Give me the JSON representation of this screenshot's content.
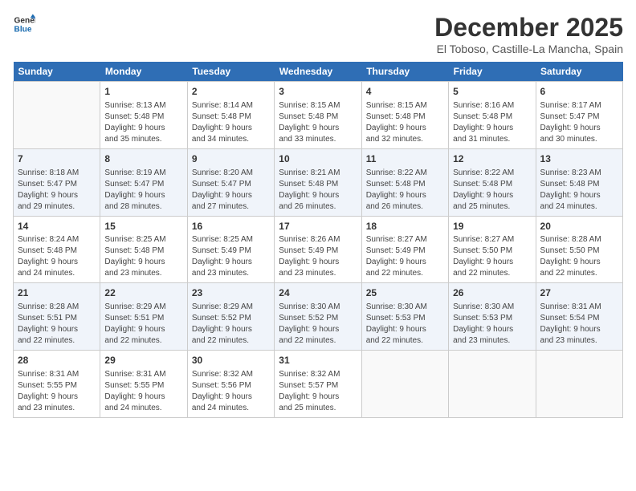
{
  "logo": {
    "line1": "General",
    "line2": "Blue"
  },
  "title": "December 2025",
  "subtitle": "El Toboso, Castille-La Mancha, Spain",
  "days_of_week": [
    "Sunday",
    "Monday",
    "Tuesday",
    "Wednesday",
    "Thursday",
    "Friday",
    "Saturday"
  ],
  "weeks": [
    [
      {
        "day": "",
        "info": ""
      },
      {
        "day": "1",
        "info": "Sunrise: 8:13 AM\nSunset: 5:48 PM\nDaylight: 9 hours\nand 35 minutes."
      },
      {
        "day": "2",
        "info": "Sunrise: 8:14 AM\nSunset: 5:48 PM\nDaylight: 9 hours\nand 34 minutes."
      },
      {
        "day": "3",
        "info": "Sunrise: 8:15 AM\nSunset: 5:48 PM\nDaylight: 9 hours\nand 33 minutes."
      },
      {
        "day": "4",
        "info": "Sunrise: 8:15 AM\nSunset: 5:48 PM\nDaylight: 9 hours\nand 32 minutes."
      },
      {
        "day": "5",
        "info": "Sunrise: 8:16 AM\nSunset: 5:48 PM\nDaylight: 9 hours\nand 31 minutes."
      },
      {
        "day": "6",
        "info": "Sunrise: 8:17 AM\nSunset: 5:47 PM\nDaylight: 9 hours\nand 30 minutes."
      }
    ],
    [
      {
        "day": "7",
        "info": "Sunrise: 8:18 AM\nSunset: 5:47 PM\nDaylight: 9 hours\nand 29 minutes."
      },
      {
        "day": "8",
        "info": "Sunrise: 8:19 AM\nSunset: 5:47 PM\nDaylight: 9 hours\nand 28 minutes."
      },
      {
        "day": "9",
        "info": "Sunrise: 8:20 AM\nSunset: 5:47 PM\nDaylight: 9 hours\nand 27 minutes."
      },
      {
        "day": "10",
        "info": "Sunrise: 8:21 AM\nSunset: 5:48 PM\nDaylight: 9 hours\nand 26 minutes."
      },
      {
        "day": "11",
        "info": "Sunrise: 8:22 AM\nSunset: 5:48 PM\nDaylight: 9 hours\nand 26 minutes."
      },
      {
        "day": "12",
        "info": "Sunrise: 8:22 AM\nSunset: 5:48 PM\nDaylight: 9 hours\nand 25 minutes."
      },
      {
        "day": "13",
        "info": "Sunrise: 8:23 AM\nSunset: 5:48 PM\nDaylight: 9 hours\nand 24 minutes."
      }
    ],
    [
      {
        "day": "14",
        "info": "Sunrise: 8:24 AM\nSunset: 5:48 PM\nDaylight: 9 hours\nand 24 minutes."
      },
      {
        "day": "15",
        "info": "Sunrise: 8:25 AM\nSunset: 5:48 PM\nDaylight: 9 hours\nand 23 minutes."
      },
      {
        "day": "16",
        "info": "Sunrise: 8:25 AM\nSunset: 5:49 PM\nDaylight: 9 hours\nand 23 minutes."
      },
      {
        "day": "17",
        "info": "Sunrise: 8:26 AM\nSunset: 5:49 PM\nDaylight: 9 hours\nand 23 minutes."
      },
      {
        "day": "18",
        "info": "Sunrise: 8:27 AM\nSunset: 5:49 PM\nDaylight: 9 hours\nand 22 minutes."
      },
      {
        "day": "19",
        "info": "Sunrise: 8:27 AM\nSunset: 5:50 PM\nDaylight: 9 hours\nand 22 minutes."
      },
      {
        "day": "20",
        "info": "Sunrise: 8:28 AM\nSunset: 5:50 PM\nDaylight: 9 hours\nand 22 minutes."
      }
    ],
    [
      {
        "day": "21",
        "info": "Sunrise: 8:28 AM\nSunset: 5:51 PM\nDaylight: 9 hours\nand 22 minutes."
      },
      {
        "day": "22",
        "info": "Sunrise: 8:29 AM\nSunset: 5:51 PM\nDaylight: 9 hours\nand 22 minutes."
      },
      {
        "day": "23",
        "info": "Sunrise: 8:29 AM\nSunset: 5:52 PM\nDaylight: 9 hours\nand 22 minutes."
      },
      {
        "day": "24",
        "info": "Sunrise: 8:30 AM\nSunset: 5:52 PM\nDaylight: 9 hours\nand 22 minutes."
      },
      {
        "day": "25",
        "info": "Sunrise: 8:30 AM\nSunset: 5:53 PM\nDaylight: 9 hours\nand 22 minutes."
      },
      {
        "day": "26",
        "info": "Sunrise: 8:30 AM\nSunset: 5:53 PM\nDaylight: 9 hours\nand 23 minutes."
      },
      {
        "day": "27",
        "info": "Sunrise: 8:31 AM\nSunset: 5:54 PM\nDaylight: 9 hours\nand 23 minutes."
      }
    ],
    [
      {
        "day": "28",
        "info": "Sunrise: 8:31 AM\nSunset: 5:55 PM\nDaylight: 9 hours\nand 23 minutes."
      },
      {
        "day": "29",
        "info": "Sunrise: 8:31 AM\nSunset: 5:55 PM\nDaylight: 9 hours\nand 24 minutes."
      },
      {
        "day": "30",
        "info": "Sunrise: 8:32 AM\nSunset: 5:56 PM\nDaylight: 9 hours\nand 24 minutes."
      },
      {
        "day": "31",
        "info": "Sunrise: 8:32 AM\nSunset: 5:57 PM\nDaylight: 9 hours\nand 25 minutes."
      },
      {
        "day": "",
        "info": ""
      },
      {
        "day": "",
        "info": ""
      },
      {
        "day": "",
        "info": ""
      }
    ]
  ]
}
